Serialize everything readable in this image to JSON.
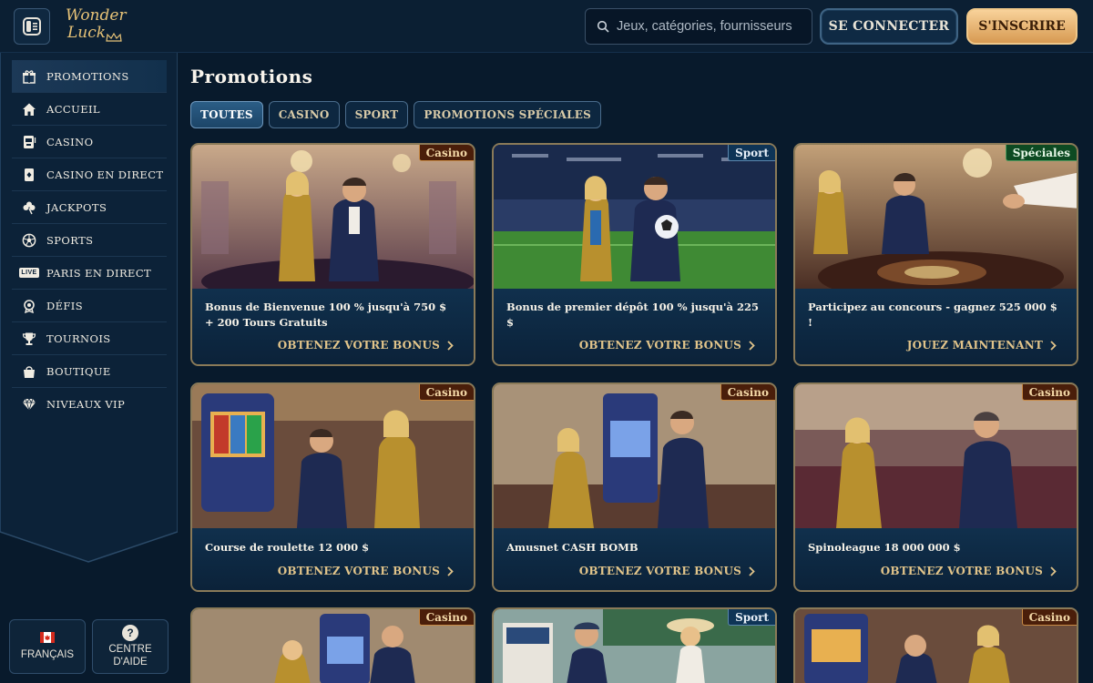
{
  "header": {
    "logo_line1": "Wonder",
    "logo_line2": "Luck",
    "search_placeholder": "Jeux, catégories, fournisseurs",
    "login_label": "SE CONNECTER",
    "signup_label": "S'INSCRIRE",
    "colors": {
      "accent_gold": "#e6c277",
      "signup_bg": "#d79a52",
      "background": "#081a2c"
    }
  },
  "sidebar": {
    "items": [
      {
        "label": "Promotions",
        "icon": "gift-icon",
        "active": true
      },
      {
        "label": "Accueil",
        "icon": "home-icon"
      },
      {
        "label": "Casino",
        "icon": "slot-machine-icon"
      },
      {
        "label": "Casino en direct",
        "icon": "cards-icon"
      },
      {
        "label": "Jackpots",
        "icon": "clover-icon"
      },
      {
        "label": "Sports",
        "icon": "soccer-ball-icon"
      },
      {
        "label": "Paris en direct",
        "icon": "live-icon"
      },
      {
        "label": "Défis",
        "icon": "medal-icon"
      },
      {
        "label": "Tournois",
        "icon": "trophy-icon"
      },
      {
        "label": "Boutique",
        "icon": "shopping-bag-icon"
      },
      {
        "label": "Niveaux VIP",
        "icon": "diamond-icon"
      }
    ],
    "live_text": "LIVE",
    "language_label": "FRANÇAIS",
    "help_label_1": "CENTRE",
    "help_label_2": "D'AIDE",
    "help_symbol": "?"
  },
  "main": {
    "title": "Promotions",
    "tabs": [
      "TOUTES",
      "CASINO",
      "SPORT",
      "PROMOTIONS SPÉCIALES"
    ],
    "active_tab": 0,
    "cards": [
      {
        "badge": "Casino",
        "badge_type": "casino",
        "title_line1": "Bonus de Bienvenue 100 % jusqu'à 750 $",
        "title_line2": "+ 200 Tours Gratuits",
        "cta": "OBTENEZ VOTRE BONUS"
      },
      {
        "badge": "Sport",
        "badge_type": "sport",
        "title_line1": "Bonus de premier dépôt 100 % jusqu'à 225 $",
        "title_line2": "",
        "cta": "OBTENEZ VOTRE BONUS"
      },
      {
        "badge": "Spéciales",
        "badge_type": "special",
        "title_line1": "Participez au concours - gagnez 525 000 $ !",
        "title_line2": "",
        "cta": "JOUEZ MAINTENANT"
      },
      {
        "badge": "Casino",
        "badge_type": "casino",
        "title_line1": "Course de roulette 12 000 $",
        "title_line2": "",
        "cta": "OBTENEZ VOTRE BONUS"
      },
      {
        "badge": "Casino",
        "badge_type": "casino",
        "title_line1": "Amusnet CASH BOMB",
        "title_line2": "",
        "cta": "OBTENEZ VOTRE BONUS"
      },
      {
        "badge": "Casino",
        "badge_type": "casino",
        "title_line1": "Spinoleague 18 000 000 $",
        "title_line2": "",
        "cta": "OBTENEZ VOTRE BONUS"
      },
      {
        "badge": "Casino",
        "badge_type": "casino"
      },
      {
        "badge": "Sport",
        "badge_type": "sport"
      },
      {
        "badge": "Casino",
        "badge_type": "casino"
      }
    ]
  }
}
